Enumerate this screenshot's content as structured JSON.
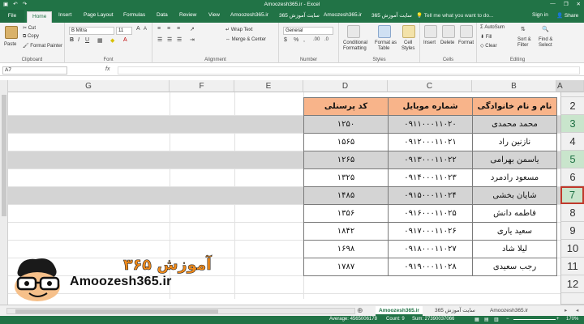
{
  "window": {
    "title": "Amoozesh365.ir - Excel",
    "controls": [
      "—",
      "❐",
      "✕"
    ]
  },
  "ribbon_tabs": {
    "file": "File",
    "home": "Home",
    "insert": "Insert",
    "page_layout": "Page Layout",
    "formulas": "Formulas",
    "data": "Data",
    "review": "Review",
    "view": "View",
    "site1": "Amoozesh365.ir",
    "site2": "سایت آموزش 365",
    "site3": "Amoozesh365.ir",
    "site4": "سایت آموزش 365",
    "tellme": "Tell me what you want to do...",
    "signin": "Sign in",
    "share": "Share"
  },
  "ribbon": {
    "clipboard": {
      "label": "Clipboard",
      "paste": "Paste",
      "cut": "Cut",
      "copy": "Copy",
      "format_painter": "Format Painter"
    },
    "font": {
      "label": "Font",
      "name": "B Mitra",
      "size": "11",
      "bold": "B",
      "italic": "I",
      "underline": "U"
    },
    "alignment": {
      "label": "Alignment",
      "wrap": "Wrap Text",
      "merge": "Merge & Center"
    },
    "number": {
      "label": "Number",
      "format": "General",
      "percent": "%",
      "comma": ","
    },
    "styles": {
      "label": "Styles",
      "conditional": "Conditional",
      "conditional2": "Formatting",
      "format_as": "Format as",
      "format_as2": "Table",
      "cell": "Cell",
      "cell2": "Styles"
    },
    "cells": {
      "label": "Cells",
      "insert": "Insert",
      "delete": "Delete",
      "format": "Format"
    },
    "editing": {
      "label": "Editing",
      "autosum": "AutoSum",
      "fill": "Fill",
      "clear": "Clear",
      "sort": "Sort &",
      "sort2": "Filter",
      "find": "Find &",
      "find2": "Select"
    }
  },
  "formula_bar": {
    "name_box": "A7",
    "fx": "fx",
    "content": ""
  },
  "columns": [
    "G",
    "F",
    "E",
    "D",
    "C",
    "B",
    "A"
  ],
  "rows": [
    "2",
    "3",
    "4",
    "5",
    "6",
    "7",
    "8",
    "9",
    "10",
    "11",
    "12"
  ],
  "table": {
    "headers": [
      "نام و نام خانوادگی",
      "شماره موبایل",
      "کد پرسنلی"
    ],
    "rows": [
      [
        "محمد محمدی",
        "۰۹۱۱۰۰۰۱۱۰۲۰",
        "۱۲۵۰"
      ],
      [
        "نازنین راد",
        "۰۹۱۲۰۰۰۱۱۰۲۱",
        "۱۵۶۵"
      ],
      [
        "یاسمن بهرامی",
        "۰۹۱۳۰۰۰۱۱۰۲۲",
        "۱۲۶۵"
      ],
      [
        "مسعود رادمرد",
        "۰۹۱۴۰۰۰۱۱۰۲۳",
        "۱۳۲۵"
      ],
      [
        "شایان بخشی",
        "۰۹۱۵۰۰۰۱۱۰۲۴",
        "۱۴۸۵"
      ],
      [
        "فاطمه دانش",
        "۰۹۱۶۰۰۰۱۱۰۲۵",
        "۱۳۵۶"
      ],
      [
        "سعید یاری",
        "۰۹۱۷۰۰۰۱۱۰۲۶",
        "۱۸۴۲"
      ],
      [
        "لیلا شاد",
        "۰۹۱۸۰۰۰۱۱۰۲۷",
        "۱۶۹۸"
      ],
      [
        "رجب سعیدی",
        "۰۹۱۹۰۰۰۱۱۰۲۸",
        "۱۷۸۷"
      ]
    ]
  },
  "logo": {
    "text": "Amoozesh365.ir",
    "fa_text": "آموزش ۳۶۵"
  },
  "sheets": [
    "Amoozesh365.ir",
    "سایت آموزش 365",
    "Amoozesh365.ir"
  ],
  "status": {
    "average": "Average: 4565006178",
    "count": "Count: 9",
    "sum": "Sum: 27390037066",
    "zoom": "170%"
  },
  "colors": {
    "excel_green": "#217346",
    "header_orange": "#f8b48a",
    "band_gray": "#d4d4d4",
    "active_red": "#c0392b"
  }
}
